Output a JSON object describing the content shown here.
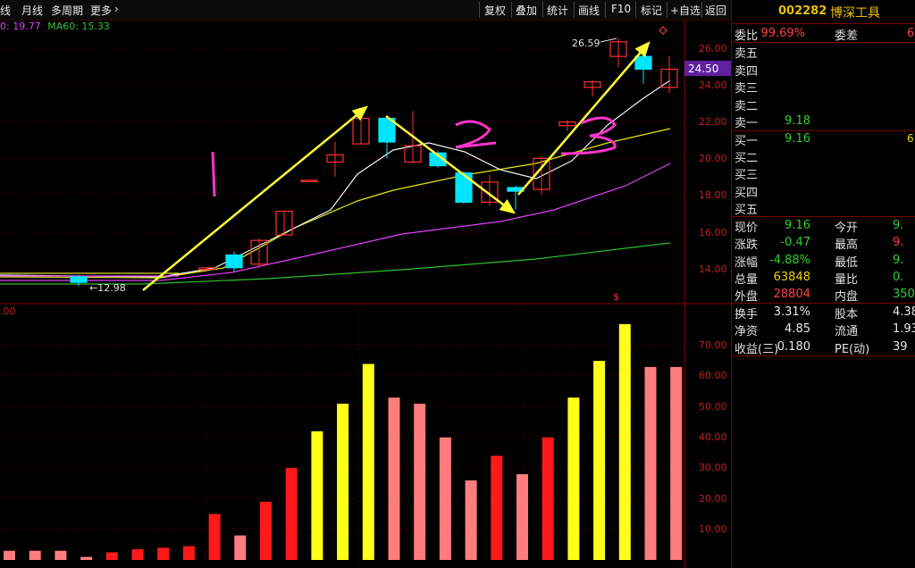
{
  "toolbar": {
    "tabs": [
      "线",
      "月线",
      "多周期",
      "更多"
    ],
    "buttons": [
      "复权",
      "叠加",
      "统计",
      "画线",
      "F10",
      "标记",
      "+自选",
      "返回"
    ]
  },
  "ma_legend": {
    "ma_a": "0: 19.77",
    "ma60": "MA60: 15.33"
  },
  "price_axis": {
    "ticks": [
      "26.00",
      "24.00",
      "22.00",
      "20.00",
      "18.00",
      "16.00",
      "14.00"
    ],
    "current_price_tag": "24.50"
  },
  "volume_axis": {
    "ticks": [
      "70.00",
      "60.00",
      "50.00",
      "40.00",
      "30.00",
      "20.00",
      "10.00"
    ],
    "top_label": ".00"
  },
  "annotations": {
    "high_label": "26.59",
    "low_label": "12.98",
    "stroke_numbers": [
      "1",
      "2",
      "3"
    ],
    "marker": "$"
  },
  "candles": [
    {
      "o": 13.5,
      "c": 13.2,
      "h": 13.6,
      "l": 13.0,
      "bull": false
    },
    {
      "o": 13.9,
      "c": 14.0,
      "h": 14.0,
      "l": 13.9,
      "bull": true
    },
    {
      "o": 14.7,
      "c": 14.0,
      "h": 14.9,
      "l": 13.8,
      "bull": false
    },
    {
      "o": 14.2,
      "c": 15.5,
      "h": 15.6,
      "l": 14.0,
      "bull": true
    },
    {
      "o": 15.8,
      "c": 17.1,
      "h": 17.1,
      "l": 15.8,
      "bull": true
    },
    {
      "o": 18.8,
      "c": 18.8,
      "h": 18.8,
      "l": 18.8,
      "bull": true
    },
    {
      "o": 19.8,
      "c": 20.2,
      "h": 20.9,
      "l": 19.0,
      "bull": true
    },
    {
      "o": 20.8,
      "c": 22.2,
      "h": 22.5,
      "l": 20.8,
      "bull": true
    },
    {
      "o": 22.2,
      "c": 20.9,
      "h": 22.3,
      "l": 20.0,
      "bull": false
    },
    {
      "o": 19.8,
      "c": 20.7,
      "h": 22.6,
      "l": 19.8,
      "bull": true
    },
    {
      "o": 20.3,
      "c": 19.6,
      "h": 20.4,
      "l": 19.5,
      "bull": false
    },
    {
      "o": 19.2,
      "c": 17.6,
      "h": 19.3,
      "l": 17.5,
      "bull": false
    },
    {
      "o": 17.6,
      "c": 18.7,
      "h": 19.1,
      "l": 17.4,
      "bull": true
    },
    {
      "o": 18.4,
      "c": 18.2,
      "h": 18.5,
      "l": 17.2,
      "bull": false
    },
    {
      "o": 18.3,
      "c": 20.0,
      "h": 20.1,
      "l": 18.0,
      "bull": true
    },
    {
      "o": 21.8,
      "c": 22.0,
      "h": 22.1,
      "l": 21.5,
      "bull": true
    },
    {
      "o": 23.9,
      "c": 24.2,
      "h": 24.3,
      "l": 23.4,
      "bull": true
    },
    {
      "o": 25.6,
      "c": 26.4,
      "h": 26.59,
      "l": 25.0,
      "bull": true
    },
    {
      "o": 25.6,
      "c": 24.9,
      "h": 25.9,
      "l": 24.1,
      "bull": false
    },
    {
      "o": 23.9,
      "c": 24.9,
      "h": 25.6,
      "l": 23.6,
      "bull": true
    }
  ],
  "volumes": [
    {
      "v": 3.0,
      "c": "salmon"
    },
    {
      "v": 3.0,
      "c": "salmon"
    },
    {
      "v": 3.0,
      "c": "salmon"
    },
    {
      "v": 1.0,
      "c": "salmon"
    },
    {
      "v": 2.5,
      "c": "red"
    },
    {
      "v": 3.5,
      "c": "red"
    },
    {
      "v": 4.0,
      "c": "red"
    },
    {
      "v": 4.5,
      "c": "red"
    },
    {
      "v": 15,
      "c": "red"
    },
    {
      "v": 8,
      "c": "salmon"
    },
    {
      "v": 19,
      "c": "red"
    },
    {
      "v": 30,
      "c": "red"
    },
    {
      "v": 42,
      "c": "yellow"
    },
    {
      "v": 51,
      "c": "yellow"
    },
    {
      "v": 64,
      "c": "yellow"
    },
    {
      "v": 53,
      "c": "salmon"
    },
    {
      "v": 51,
      "c": "salmon"
    },
    {
      "v": 40,
      "c": "salmon"
    },
    {
      "v": 26,
      "c": "salmon"
    },
    {
      "v": 34,
      "c": "red"
    },
    {
      "v": 28,
      "c": "salmon"
    },
    {
      "v": 40,
      "c": "red"
    },
    {
      "v": 53,
      "c": "yellow"
    },
    {
      "v": 65,
      "c": "yellow"
    },
    {
      "v": 77,
      "c": "yellow"
    },
    {
      "v": 63,
      "c": "salmon"
    },
    {
      "v": 63,
      "c": "salmon"
    }
  ],
  "quote": {
    "code": "002282",
    "name": "博深工具",
    "weibi_label": "委比",
    "weibi": "99.69%",
    "weicha_label": "委差",
    "weicha": "6",
    "asks": [
      {
        "label": "卖五",
        "price": "",
        "vol": ""
      },
      {
        "label": "卖四",
        "price": "",
        "vol": ""
      },
      {
        "label": "卖三",
        "price": "",
        "vol": ""
      },
      {
        "label": "卖二",
        "price": "",
        "vol": ""
      },
      {
        "label": "卖一",
        "price": "9.18",
        "vol": ""
      }
    ],
    "bids": [
      {
        "label": "买一",
        "price": "9.16",
        "vol": "6"
      },
      {
        "label": "买二",
        "price": "",
        "vol": ""
      },
      {
        "label": "买三",
        "price": "",
        "vol": ""
      },
      {
        "label": "买四",
        "price": "",
        "vol": ""
      },
      {
        "label": "买五",
        "price": "",
        "vol": ""
      }
    ],
    "stats": [
      {
        "l": "现价",
        "v": "9.16",
        "vc": "green",
        "l2": "今开",
        "v2": "9.",
        "v2c": "green"
      },
      {
        "l": "涨跌",
        "v": "-0.47",
        "vc": "green",
        "l2": "最高",
        "v2": "9.",
        "v2c": "red"
      },
      {
        "l": "涨幅",
        "v": "-4.88%",
        "vc": "green",
        "l2": "最低",
        "v2": "9.",
        "v2c": "green"
      },
      {
        "l": "总量",
        "v": "63848",
        "vc": "yellow",
        "l2": "量比",
        "v2": "0.",
        "v2c": "green"
      },
      {
        "l": "外盘",
        "v": "28804",
        "vc": "red",
        "l2": "内盘",
        "v2": "350",
        "v2c": "green"
      }
    ],
    "fin": [
      {
        "l": "换手",
        "v": "3.31%",
        "l2": "股本",
        "v2": "4.38"
      },
      {
        "l": "净资",
        "v": "4.85",
        "l2": "流通",
        "v2": "1.93"
      },
      {
        "l": "收益(三)",
        "v": "0.180",
        "l2": "PE(动)",
        "v2": "39"
      }
    ]
  },
  "colors": {
    "bull": "#ff3030",
    "bear": "#00e5ff",
    "ma_white": "#f0f0f0",
    "ma_yellow": "#e6e600",
    "ma_purple": "#e040fb",
    "ma_green": "#30c030",
    "arrow": "#ffff33",
    "pen": "#ff33cc"
  }
}
